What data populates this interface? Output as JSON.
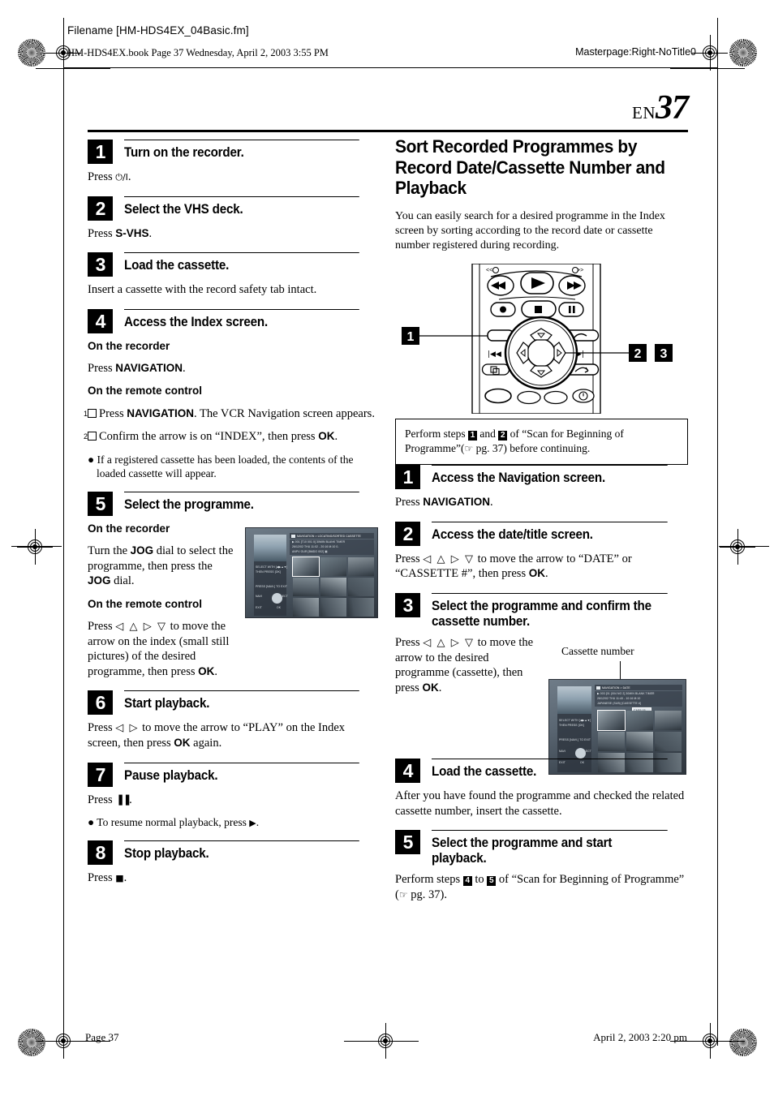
{
  "header": {
    "filename": "Filename [HM-HDS4EX_04Basic.fm]",
    "bookline": "HM-HDS4EX.book  Page 37  Wednesday, April 2, 2003  3:55 PM",
    "masterpage": "Masterpage:Right-NoTitle0"
  },
  "page": {
    "lang_code": "EN",
    "number": "37"
  },
  "left_column": {
    "steps": [
      {
        "num": "1",
        "title": "Turn on the recorder.",
        "body": [
          {
            "type": "para",
            "runs": [
              {
                "t": "Press "
              },
              {
                "t": "⏻/I",
                "style": "sym"
              },
              {
                "t": "."
              }
            ]
          }
        ]
      },
      {
        "num": "2",
        "title": "Select the VHS deck.",
        "body": [
          {
            "type": "para",
            "runs": [
              {
                "t": "Press "
              },
              {
                "t": "S-VHS",
                "style": "b"
              },
              {
                "t": "."
              }
            ]
          }
        ]
      },
      {
        "num": "3",
        "title": "Load the cassette.",
        "body": [
          {
            "type": "para",
            "runs": [
              {
                "t": "Insert a cassette with the record safety tab intact."
              }
            ]
          }
        ]
      },
      {
        "num": "4",
        "title": "Access the Index screen.",
        "body": [
          {
            "type": "subhead",
            "text": "On the recorder"
          },
          {
            "type": "para",
            "runs": [
              {
                "t": "Press "
              },
              {
                "t": "NAVIGATION",
                "style": "b"
              },
              {
                "t": "."
              }
            ]
          },
          {
            "type": "subhead",
            "text": "On the remote control"
          },
          {
            "type": "numitem",
            "box": "1",
            "runs": [
              {
                "t": "Press "
              },
              {
                "t": "NAVIGATION",
                "style": "b"
              },
              {
                "t": ". The VCR Navigation screen appears."
              }
            ]
          },
          {
            "type": "numitem",
            "box": "2",
            "runs": [
              {
                "t": "Confirm the arrow is on “INDEX”, then press "
              },
              {
                "t": "OK",
                "style": "b"
              },
              {
                "t": "."
              }
            ]
          },
          {
            "type": "bullet",
            "runs": [
              {
                "t": "If a registered cassette has been loaded, the contents of the loaded cassette will appear."
              }
            ]
          }
        ]
      },
      {
        "num": "5",
        "title": "Select the programme.",
        "body": [
          {
            "type": "subhead",
            "text": "On the recorder"
          },
          {
            "type": "para",
            "runs": [
              {
                "t": "Turn the "
              },
              {
                "t": "JOG",
                "style": "b"
              },
              {
                "t": " dial to select the programme, then press the "
              },
              {
                "t": "JOG",
                "style": "b"
              },
              {
                "t": " dial."
              }
            ]
          },
          {
            "type": "subhead",
            "text": "On the remote control"
          },
          {
            "type": "para",
            "runs": [
              {
                "t": "Press "
              },
              {
                "t": "◁ △ ▷ ▽",
                "style": "arrows"
              },
              {
                "t": " to move the arrow on the index (small still pictures) of the desired programme, then press "
              },
              {
                "t": "OK",
                "style": "b"
              },
              {
                "t": "."
              }
            ]
          }
        ]
      },
      {
        "num": "6",
        "title": "Start playback.",
        "body": [
          {
            "type": "para",
            "runs": [
              {
                "t": "Press "
              },
              {
                "t": "◁ ▷",
                "style": "arrows"
              },
              {
                "t": " to move the arrow to “PLAY” on the Index screen, then press "
              },
              {
                "t": "OK",
                "style": "b"
              },
              {
                "t": " again."
              }
            ]
          }
        ]
      },
      {
        "num": "7",
        "title": "Pause playback.",
        "body": [
          {
            "type": "para",
            "runs": [
              {
                "t": "Press "
              },
              {
                "t": "▐▐",
                "style": "sym"
              },
              {
                "t": "."
              }
            ]
          },
          {
            "type": "bullet",
            "runs": [
              {
                "t": "To resume normal playback, press "
              },
              {
                "t": "▶",
                "style": "sym"
              },
              {
                "t": "."
              }
            ]
          }
        ]
      },
      {
        "num": "8",
        "title": "Stop playback.",
        "body": [
          {
            "type": "para",
            "runs": [
              {
                "t": "Press "
              },
              {
                "t": "■",
                "style": "sym"
              },
              {
                "t": "."
              }
            ]
          }
        ]
      }
    ]
  },
  "right_column": {
    "section_title": "Sort Recorded Programmes by Record Date/Cassette Number and Playback",
    "section_intro": "You can easily search for a desired programme in the Index screen by sorting according to the record date or cassette number registered during recording.",
    "remote_callouts": [
      "1",
      "2",
      "3"
    ],
    "notebox": {
      "runs": [
        {
          "t": "Perform steps "
        },
        {
          "t": "1",
          "style": "inv"
        },
        {
          "t": " and "
        },
        {
          "t": "2",
          "style": "inv"
        },
        {
          "t": " of “Scan for Beginning of Programme”("
        },
        {
          "t": "☞",
          "style": "hand"
        },
        {
          "t": " pg. 37) before continuing."
        }
      ]
    },
    "steps": [
      {
        "num": "1",
        "title": "Access the Navigation screen.",
        "body": [
          {
            "type": "para",
            "runs": [
              {
                "t": "Press "
              },
              {
                "t": "NAVIGATION",
                "style": "b"
              },
              {
                "t": "."
              }
            ]
          }
        ]
      },
      {
        "num": "2",
        "title": "Access the date/title screen.",
        "body": [
          {
            "type": "para",
            "runs": [
              {
                "t": "Press "
              },
              {
                "t": "◁ △ ▷ ▽",
                "style": "arrows"
              },
              {
                "t": " to move the arrow to “DATE” or “CASSETTE #”, then press "
              },
              {
                "t": "OK",
                "style": "b"
              },
              {
                "t": "."
              }
            ]
          }
        ]
      },
      {
        "num": "3",
        "title": "Select the programme and confirm the cassette number.",
        "body": [
          {
            "type": "para",
            "runs": [
              {
                "t": "Press "
              },
              {
                "t": "◁ △ ▷ ▽",
                "style": "arrows"
              },
              {
                "t": " to move the arrow to the desired programme (cassette), then press "
              },
              {
                "t": "OK",
                "style": "b"
              },
              {
                "t": "."
              }
            ]
          }
        ],
        "callout_label": "Cassette number"
      },
      {
        "num": "4",
        "title": "Load the cassette.",
        "body": [
          {
            "type": "para",
            "runs": [
              {
                "t": "After you have found the programme and checked the related cassette number, insert the cassette."
              }
            ]
          }
        ]
      },
      {
        "num": "5",
        "title": "Select the programme and start playback.",
        "body": [
          {
            "type": "para",
            "runs": [
              {
                "t": "Perform steps "
              },
              {
                "t": "4",
                "style": "inv"
              },
              {
                "t": " to "
              },
              {
                "t": "5",
                "style": "inv"
              },
              {
                "t": " of “Scan for Beginning of Programme” ("
              },
              {
                "t": "☞",
                "style": "hand"
              },
              {
                "t": " pg. 37)."
              }
            ]
          }
        ]
      }
    ]
  },
  "tv_index_screen": {
    "title_bar": "NAVIGATION > LOCATING/SORTED CASSETTE",
    "info_line_1": "▶ 001  [T10 001 0]      30MIN BLANK TIMER",
    "info_line_2": "26/12/02 THU 11:02 - 20:16    M:10        0-",
    "info_line_3": "ANPV OUR                       [BMDO 002] ▣",
    "side_labels": [
      "SELECT WITH [◀▶▲▼]",
      "THEN PRESS [OK]",
      "PRESS [NAVI.] TO EXIT"
    ],
    "bottom_labels": [
      "NAVI",
      "SELECT",
      "EXIT",
      "OK"
    ]
  },
  "tv_date_screen": {
    "title_bar": "NAVIGATION > DATE",
    "info_line_1": "▶ 003 [01 (004 NO 2]      30MIN BLANK TIMER",
    "info_line_2": "26/12/02 THU  11:40 - 10:16    M:10",
    "info_line_3": "JAPANESE (SUB)                [CASSETTE #]",
    "cassette_number_value": "CASS 03",
    "side_labels": [
      "SELECT WITH [◀▶▲▼]",
      "THEN PRESS [OK]",
      "PRESS [NAVI.] TO EXIT"
    ],
    "bottom_labels": [
      "NAVI",
      "SELECT",
      "EXIT",
      "OK"
    ]
  },
  "footer": {
    "left": "Page 37",
    "right": "April 2, 2003 2:20 pm"
  }
}
